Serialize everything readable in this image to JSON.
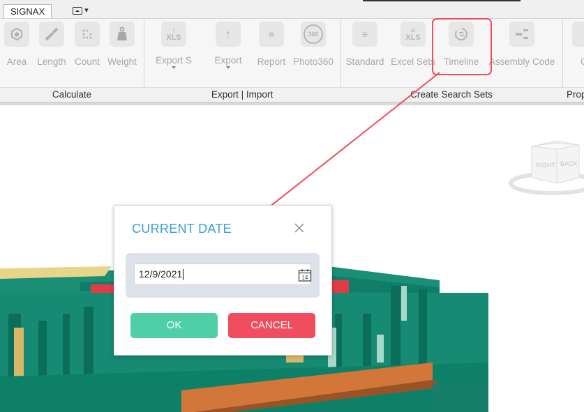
{
  "tab": {
    "label": "SIGNAX"
  },
  "ribbon": {
    "groups": [
      {
        "title": "Calculate"
      },
      {
        "title": "Export | Import"
      },
      {
        "title": "Create Search Sets"
      },
      {
        "title": "Prop"
      }
    ],
    "buttons": {
      "area": "Area",
      "length": "Length",
      "count": "Count",
      "weight": "Weight",
      "export_s": "Export S",
      "export_s_icon_text": "XLS",
      "export": "Export",
      "report": "Report",
      "photo360": "Photo360",
      "photo360_icon_text": "360",
      "standard": "Standard",
      "excel_sets": "Excel Sets",
      "excel_sets_icon_text": "XLS",
      "timeline": "Timeline",
      "assembly_code": "Assembly Code",
      "cut_off": "C"
    }
  },
  "viewcube": {
    "right": "RIGHT",
    "back": "BACK"
  },
  "dialog": {
    "title": "CURRENT DATE",
    "date_value": "12/9/2021",
    "calendar_day": "14",
    "ok_label": "OK",
    "cancel_label": "CANCEL"
  },
  "colors": {
    "accent_title": "#3aa0d8",
    "ok_button": "#4fcfa5",
    "cancel_button": "#f04d5e",
    "annotation": "#ef4e5e",
    "building_teal": "#138a72",
    "building_orange": "#d2763a"
  }
}
